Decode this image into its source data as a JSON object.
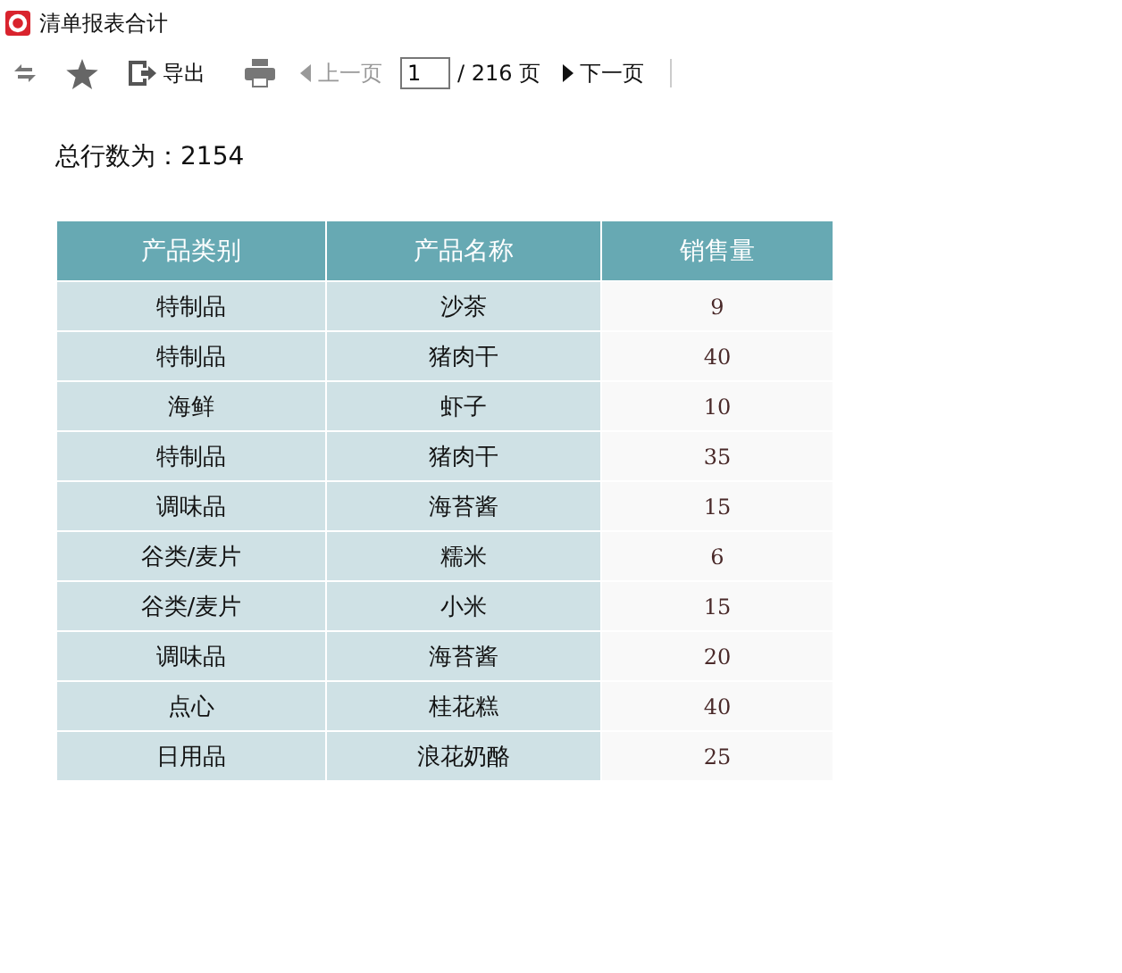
{
  "window": {
    "title": "清单报表合计"
  },
  "toolbar": {
    "export": "导出",
    "prev": {
      "label": "上一页",
      "disabled": true
    },
    "page": "1",
    "total": "/ 216 页",
    "next": {
      "label": "下一页",
      "disabled": false
    }
  },
  "summary": "总行数为：2154",
  "table": {
    "columns": [
      "产品类别",
      "产品名称",
      "销售量"
    ],
    "rows": [
      [
        "特制品",
        "沙茶",
        "9"
      ],
      [
        "特制品",
        "猪肉干",
        "40"
      ],
      [
        "海鲜",
        "虾子",
        "10"
      ],
      [
        "特制品",
        "猪肉干",
        "35"
      ],
      [
        "调味品",
        "海苔酱",
        "15"
      ],
      [
        "谷类/麦片",
        "糯米",
        "6"
      ],
      [
        "谷类/麦片",
        "小米",
        "15"
      ],
      [
        "调味品",
        "海苔酱",
        "20"
      ],
      [
        "点心",
        "桂花糕",
        "40"
      ],
      [
        "日用品",
        "浪花奶酪",
        "25"
      ]
    ]
  }
}
